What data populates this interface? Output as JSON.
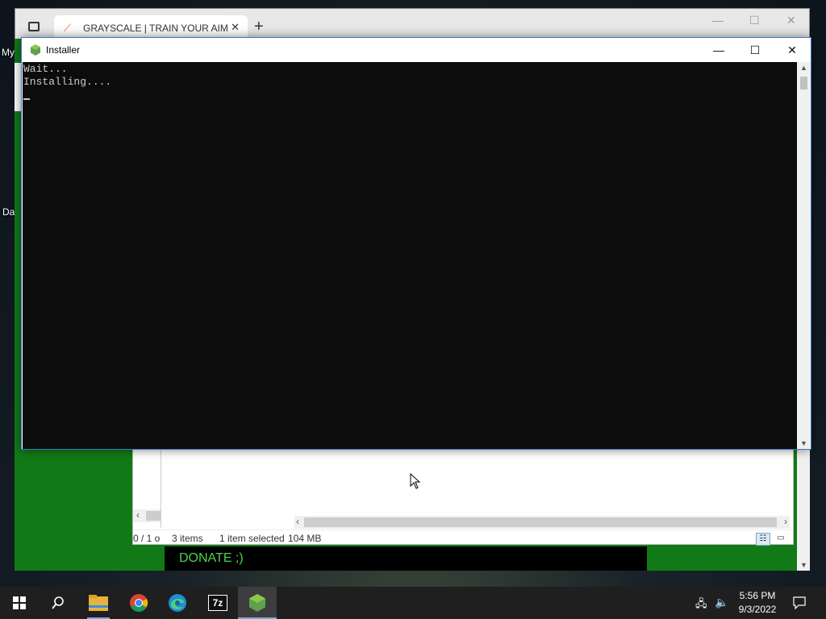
{
  "desktop": {
    "icon_labels": [
      "My",
      "Da"
    ]
  },
  "browser": {
    "tab_title": "GRAYSCALE | TRAIN YOUR AIM",
    "new_tab_glyph": "+",
    "close_glyph": "✕",
    "controls": {
      "minimize": "—",
      "maximize": "☐",
      "close": "✕"
    }
  },
  "explorer": {
    "partial_status": "0 / 1 o",
    "status": {
      "items": "3 items",
      "selected": "1 item selected",
      "size": "104 MB"
    }
  },
  "page": {
    "donate_text": "DONATE ;)"
  },
  "installer": {
    "title": "Installer",
    "controls": {
      "minimize": "—",
      "maximize": "☐",
      "close": "✕"
    },
    "console_lines": [
      "Wait...",
      "Installing...."
    ]
  },
  "taskbar": {
    "apps": [
      "start-icon",
      "search-icon",
      "file-explorer-icon",
      "chrome-icon",
      "edge-icon",
      "7zip-icon",
      "nodejs-icon"
    ],
    "sevenzip_label": "7z",
    "clock": {
      "time": "5:56 PM",
      "date": "9/3/2022"
    }
  },
  "colors": {
    "page_green": "#117a17",
    "donate_green": "#4cd24c",
    "console_bg": "#0c0c0c",
    "taskbar_bg": "#1f1f1f"
  }
}
